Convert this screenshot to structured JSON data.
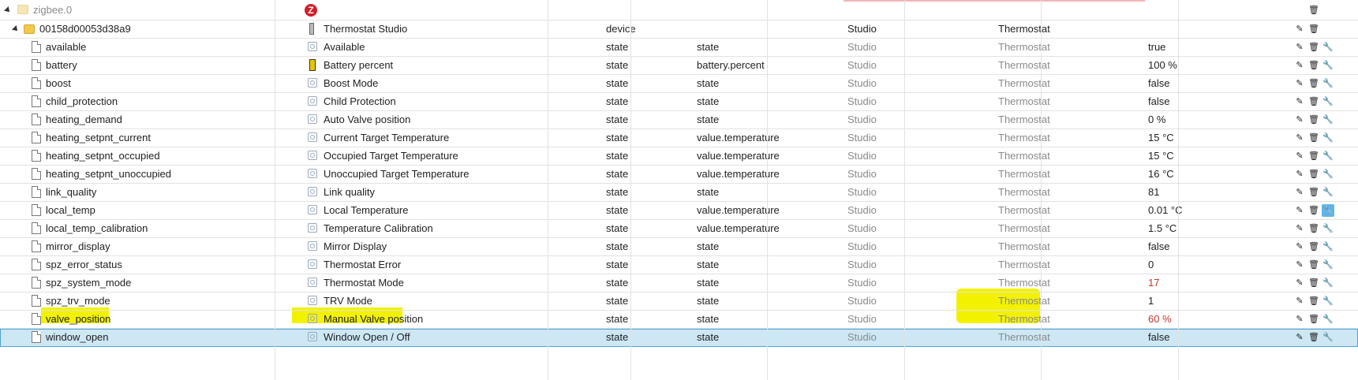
{
  "root": {
    "id": "zigbee.0",
    "icon": "zigbee-logo-icon"
  },
  "device": {
    "id": "00158d00053d38a9",
    "name": "Thermostat Studio",
    "type": "device",
    "room": "Studio",
    "function": "Thermostat"
  },
  "rows": [
    {
      "id": "available",
      "name": "Available",
      "type": "state",
      "role": "state",
      "room": "Studio",
      "function": "Thermostat",
      "value": "true"
    },
    {
      "id": "battery",
      "name": "Battery percent",
      "type": "state",
      "role": "battery.percent",
      "room": "Studio",
      "function": "Thermostat",
      "value": "100 %"
    },
    {
      "id": "boost",
      "name": "Boost Mode",
      "type": "state",
      "role": "state",
      "room": "Studio",
      "function": "Thermostat",
      "value": "false"
    },
    {
      "id": "child_protection",
      "name": "Child Protection",
      "type": "state",
      "role": "state",
      "room": "Studio",
      "function": "Thermostat",
      "value": "false"
    },
    {
      "id": "heating_demand",
      "name": "Auto Valve position",
      "type": "state",
      "role": "state",
      "room": "Studio",
      "function": "Thermostat",
      "value": "0 %"
    },
    {
      "id": "heating_setpnt_current",
      "name": "Current Target Temperature",
      "type": "state",
      "role": "value.temperature",
      "room": "Studio",
      "function": "Thermostat",
      "value": "15 °C"
    },
    {
      "id": "heating_setpnt_occupied",
      "name": "Occupied Target Temperature",
      "type": "state",
      "role": "value.temperature",
      "room": "Studio",
      "function": "Thermostat",
      "value": "15 °C"
    },
    {
      "id": "heating_setpnt_unoccupied",
      "name": "Unoccupied Target Temperature",
      "type": "state",
      "role": "value.temperature",
      "room": "Studio",
      "function": "Thermostat",
      "value": "16 °C"
    },
    {
      "id": "link_quality",
      "name": "Link quality",
      "type": "state",
      "role": "state",
      "room": "Studio",
      "function": "Thermostat",
      "value": "81"
    },
    {
      "id": "local_temp",
      "name": "Local Temperature",
      "type": "state",
      "role": "value.temperature",
      "room": "Studio",
      "function": "Thermostat",
      "value": "0.01 °C"
    },
    {
      "id": "local_temp_calibration",
      "name": "Temperature Calibration",
      "type": "state",
      "role": "value.temperature",
      "room": "Studio",
      "function": "Thermostat",
      "value": "1.5 °C"
    },
    {
      "id": "mirror_display",
      "name": "Mirror Display",
      "type": "state",
      "role": "state",
      "room": "Studio",
      "function": "Thermostat",
      "value": "false"
    },
    {
      "id": "spz_error_status",
      "name": "Thermostat Error",
      "type": "state",
      "role": "state",
      "room": "Studio",
      "function": "Thermostat",
      "value": "0"
    },
    {
      "id": "spz_system_mode",
      "name": "Thermostat Mode",
      "type": "state",
      "role": "state",
      "room": "Studio",
      "function": "Thermostat",
      "value": "17"
    },
    {
      "id": "spz_trv_mode",
      "name": "TRV Mode",
      "type": "state",
      "role": "state",
      "room": "Studio",
      "function": "Thermostat",
      "value": "1"
    },
    {
      "id": "valve_position",
      "name": "Manual Valve position",
      "type": "state",
      "role": "state",
      "room": "Studio",
      "function": "Thermostat",
      "value": "60 %"
    },
    {
      "id": "window_open",
      "name": "Window Open / Off",
      "type": "state",
      "role": "state",
      "room": "Studio",
      "function": "Thermostat",
      "value": "false"
    }
  ],
  "colors": {
    "highlight": "#f2f200",
    "selected_row": "#cde7f5",
    "value_red": "#c0392b",
    "active_button": "#62b4e8"
  },
  "icons": {
    "edit": "pencil-icon",
    "delete": "trash-icon",
    "custom": "wrench-icon"
  }
}
